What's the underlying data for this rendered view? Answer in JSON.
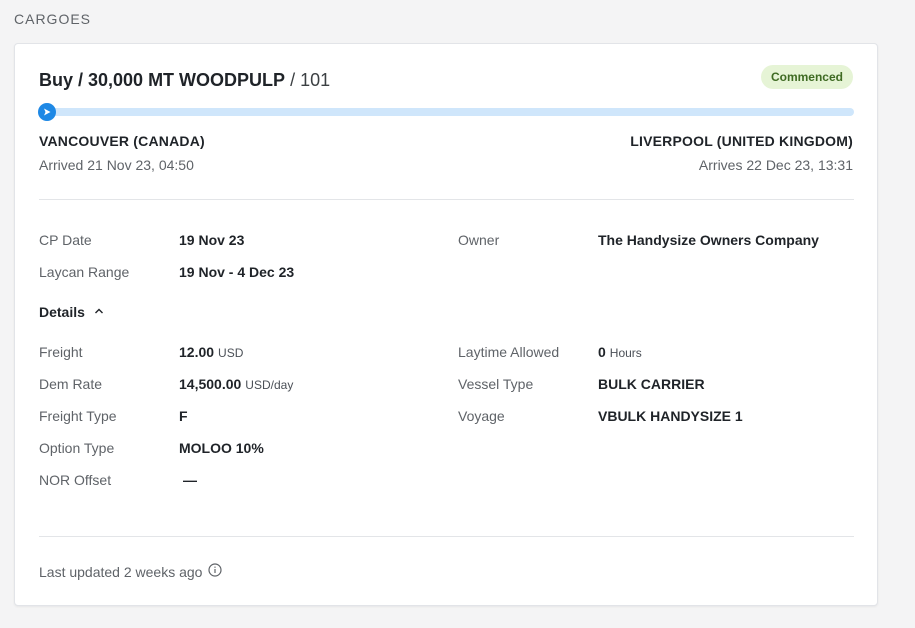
{
  "section": {
    "title": "CARGOES"
  },
  "cargo": {
    "title_main": "Buy / 30,000 MT WOODPULP",
    "title_suffix": " / 101",
    "status": "Commenced",
    "progress": 0.0,
    "colors": {
      "accent": "#1e88e5",
      "track": "#cfe6fb",
      "badge_bg": "#e6f4d6",
      "badge_text": "#3f6b23"
    },
    "origin": {
      "port": "VANCOUVER (CANADA)",
      "time": "Arrived 21 Nov 23, 04:50"
    },
    "destination": {
      "port": "LIVERPOOL (UNITED KINGDOM)",
      "time": "Arrives 22 Dec 23, 13:31"
    }
  },
  "summary": {
    "cp_date": {
      "label": "CP Date",
      "value": "19 Nov 23"
    },
    "laycan": {
      "label": "Laycan Range",
      "value": "19 Nov - 4 Dec 23"
    },
    "owner": {
      "label": "Owner",
      "value": "The Handysize Owners Company"
    }
  },
  "details": {
    "toggle_label": "Details",
    "freight": {
      "label": "Freight",
      "value": "12.00",
      "unit": "USD"
    },
    "dem_rate": {
      "label": "Dem Rate",
      "value": "14,500.00",
      "unit": "USD/day"
    },
    "freight_type": {
      "label": "Freight Type",
      "value": "F"
    },
    "option_type": {
      "label": "Option Type",
      "value": "MOLOO 10%"
    },
    "nor_offset": {
      "label": "NOR Offset",
      "value": "—"
    },
    "laytime": {
      "label": "Laytime Allowed",
      "value": "0",
      "unit": "Hours"
    },
    "vessel_type": {
      "label": "Vessel Type",
      "value": "BULK CARRIER"
    },
    "voyage": {
      "label": "Voyage",
      "value": "VBULK HANDYSIZE 1"
    }
  },
  "footer": {
    "updated": "Last updated 2 weeks ago"
  }
}
